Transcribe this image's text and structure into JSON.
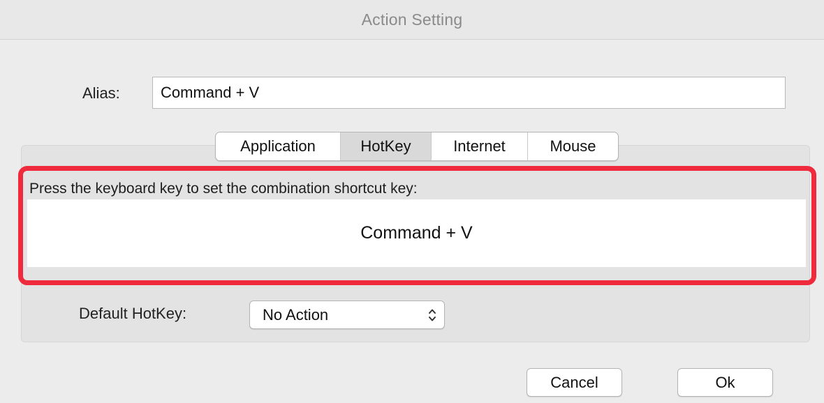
{
  "window": {
    "title": "Action Setting"
  },
  "alias": {
    "label": "Alias:",
    "value": "Command + V"
  },
  "tabs": [
    {
      "label": "Application",
      "selected": false
    },
    {
      "label": "HotKey",
      "selected": true
    },
    {
      "label": "Internet",
      "selected": false
    },
    {
      "label": "Mouse",
      "selected": false
    }
  ],
  "hotkey_panel": {
    "instruction": "Press the keyboard key to set the combination shortcut key:",
    "captured_shortcut": "Command + V",
    "highlight_color": "#ee2a3c"
  },
  "default_hotkey": {
    "label": "Default HotKey:",
    "selected_value": "No Action",
    "icon": "up-down-chevron-icon"
  },
  "buttons": {
    "cancel_label": "Cancel",
    "ok_label": "Ok"
  }
}
